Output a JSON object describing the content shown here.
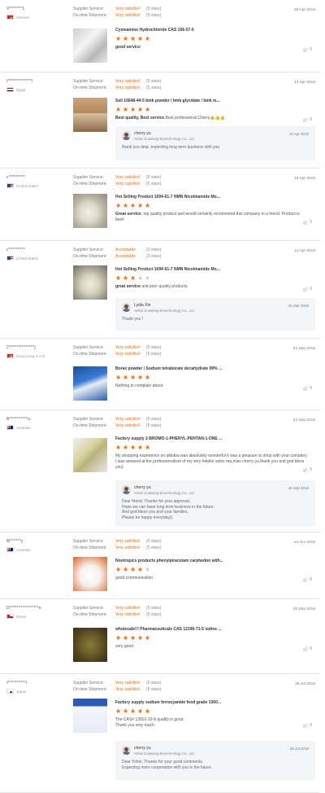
{
  "labels": {
    "supplier_service": "Supplier Service:",
    "ontime_shipment": "On-time Shipment:"
  },
  "reviews": [
    {
      "buyer": "V*******1",
      "country": "Vietnam",
      "flag": "vietnam-flag",
      "supplier_service": "Very satisfied",
      "supplier_stars": "(5 stars)",
      "shipment": "Very satisfied",
      "shipment_stars": "(5 stars)",
      "date": "20 Apr 2019",
      "product": "Cysteamine Hydrochloride CAS 156-57-0",
      "rating": 5,
      "text": "good service",
      "likes": "0",
      "reply": null
    },
    {
      "buyer": "t*************l",
      "country": "Egypt",
      "flag": "egypt-flag",
      "supplier_service": "Very satisfied",
      "supplier_stars": "(5 stars)",
      "shipment": "Very satisfied",
      "shipment_stars": "(5 stars)",
      "date": "14 Apr 2019",
      "product": "Sell 16648-44-5 bmk powder / bmk glycidate / bmk m...",
      "rating": 5,
      "text": "Best quality, Best service,Best professional Cherry👍👍👍",
      "likes": "0",
      "reply": {
        "name": "cherry yu",
        "company": "Hebei Guanlang Biotechnology Co., Ltd",
        "date": "14 Apr 2019",
        "text": "thank you dear, expecting long term business with you"
      }
    },
    {
      "buyer": "c*********",
      "country": "United States",
      "flag": "usa-flag",
      "supplier_service": "Very satisfied",
      "supplier_stars": "(5 stars)",
      "shipment": "Very satisfied",
      "shipment_stars": "(5 stars)",
      "date": "18 Apr 2019",
      "product": "Hot Selling Product 1094-61-7 NMN Nicotinamide Mo...",
      "rating": 5,
      "text": "Great service, top quality product and would certainly recommend this company to a friend. Product is best!",
      "likes": "0",
      "reply": null
    },
    {
      "buyer": "c*********",
      "country": "United States",
      "flag": "usa-flag",
      "supplier_service": "Acceptable",
      "supplier_stars": "(3 stars)",
      "shipment": "Acceptable",
      "shipment_stars": "(3 stars)",
      "date": "11 Apr 2019",
      "product": "Hot Selling Product 1094-61-7 NMN Nicotinamide Mo...",
      "rating": 3,
      "text": "great service and poor quality products.",
      "likes": "0",
      "reply": {
        "name": "Lydia Xie",
        "company": "Hebei Guanlang Biotechnology Co., Ltd",
        "date": "31 Mar 2019",
        "text": "Thank you !"
      }
    },
    {
      "buyer": "2**************j",
      "country": "Hong Kong S.A.R.",
      "flag": "hongkong-flag",
      "supplier_service": "Very satisfied",
      "supplier_stars": "(5 stars)",
      "shipment": "Very satisfied",
      "shipment_stars": "(5 stars)",
      "date": "24 Sep 2019",
      "product": "Borax powder / Sodium tetraborate decahydrate 99% ...",
      "rating": 5,
      "text": "Nothing to complain about.",
      "likes": "0",
      "reply": null
    },
    {
      "buyer": "B**********u",
      "country": "Australia",
      "flag": "australia-flag",
      "supplier_service": "Very satisfied",
      "supplier_stars": "(5 stars)",
      "shipment": "Very satisfied",
      "shipment_stars": "(5 stars)",
      "date": "24 Sep 2019",
      "product": "Factory supply 2-BROMO-1-PHENYL-PENTAN-1-ONE ...",
      "rating": 5,
      "text": "My shopping experience on alibaba was absolutely wonderful it was a pleasure to shop with your company I was amazed at the professionalism of my very helpful sales rep,miss cherry yu,thank you and god bless you)",
      "likes": "0",
      "reply": {
        "name": "cherry yu",
        "company": "Hebei Guanlang Biotechnology Co., Ltd",
        "date": "25 Sep 2019",
        "text": "Dear friend, Thanks for your approval.\nHope we can have long term business in the future.\nAnd god bless you and your families.\nPlease be happy everyday))"
      }
    },
    {
      "buyer": "M******y",
      "country": "Australia",
      "flag": "australia-flag",
      "supplier_service": "Very satisfied",
      "supplier_stars": "(5 stars)",
      "shipment": "Very satisfied",
      "shipment_stars": "(5 stars)",
      "date": "14 Oct 2019",
      "product": "Nootropics products phenylpiracetam carphedon with...",
      "rating": 4,
      "text": "good communication",
      "likes": "0",
      "reply": null
    },
    {
      "buyer": "D****************e",
      "country": "Oman",
      "flag": "oman-flag",
      "supplier_service": "Very satisfied",
      "supplier_stars": "(5 stars)",
      "shipment": "Very satisfied",
      "shipment_stars": "(5 stars)",
      "date": "30 Sep 2019",
      "product": "wholesale!!! Pharmaceuticals CAS 12190-71-5 iodine ...",
      "rating": 5,
      "text": "very good",
      "likes": "0",
      "reply": null
    },
    {
      "buyer": "Y*********i",
      "country": "Japan",
      "flag": "japan-flag",
      "supplier_service": "Very satisfied",
      "supplier_stars": "(5 stars)",
      "shipment": "Very satisfied",
      "shipment_stars": "(5 stars)",
      "date": "26 Jul 2019",
      "product": "Factory supply sodium ferrocyanide food grade 1360...",
      "rating": 5,
      "text": "The CAS# 13601-19-9 quality is good\nThank you very much",
      "likes": "0",
      "reply": {
        "name": "cherry yu",
        "company": "Hebei Guanlang Biotechnology Co., Ltd",
        "date": "26 Jul 2019",
        "text": "Dear Yohei, Thanks for your good comments.\nExpecting more cooperation with you in the future."
      }
    }
  ]
}
